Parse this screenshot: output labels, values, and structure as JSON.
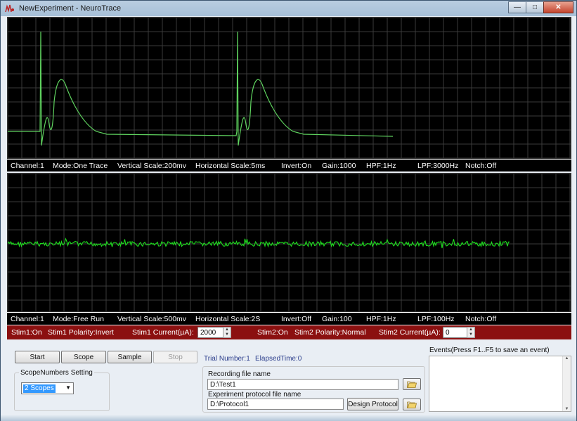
{
  "window": {
    "title": "NewExperiment - NeuroTrace",
    "controls": {
      "minimize": "—",
      "maximize": "□",
      "close": "✕"
    }
  },
  "scope1": {
    "channel": "Channel:1",
    "mode": "Mode:One Trace",
    "vscale": "Vertical Scale:200mv",
    "hscale": "Horizontal Scale:5ms",
    "invert": "Invert:On",
    "gain": "Gain:1000",
    "hpf": "HPF:1Hz",
    "lpf": "LPF:3000Hz",
    "notch": "Notch:Off"
  },
  "scope2": {
    "channel": "Channel:1",
    "mode": "Mode:Free Run",
    "vscale": "Vertical Scale:500mv",
    "hscale": "Horizontal Scale:2S",
    "invert": "Invert:Off",
    "gain": "Gain:100",
    "hpf": "HPF:1Hz",
    "lpf": "LPF:100Hz",
    "notch": "Notch:Off"
  },
  "stim": {
    "stim1_on": "Stim1:On",
    "stim1_polarity": "Stim1 Polarity:Invert",
    "stim1_current_label": "Stim1 Current(µA):",
    "stim1_current_value": "2000",
    "stim2_on": "Stim2:On",
    "stim2_polarity": "Stim2 Polarity:Normal",
    "stim2_current_label": "Stim2 Current(µA):",
    "stim2_current_value": "0"
  },
  "controls": {
    "start": "Start",
    "scope": "Scope",
    "sample": "Sample",
    "stop": "Stop",
    "trial_number": "Trial Number:1",
    "elapsed_time": "ElapsedTime:0"
  },
  "scope_numbers": {
    "title": "ScopeNumbers Setting",
    "selected": "2 Scopes"
  },
  "files": {
    "recording_label": "Recording file name",
    "recording_value": "D:\\Test1",
    "protocol_label": "Experiment protocol  file name",
    "protocol_value": "D:\\Protocol1",
    "design_protocol": "Design Protocol"
  },
  "events": {
    "label": "Events(Press F1..F5 to save an event)"
  },
  "colors": {
    "trace1": "#5fd35f",
    "trace2": "#1ee11e",
    "grid": "#3a3a3a",
    "stim_bar": "#8b1010"
  },
  "icons": [
    "app-icon",
    "folder-icon",
    "chevron-down-icon"
  ]
}
